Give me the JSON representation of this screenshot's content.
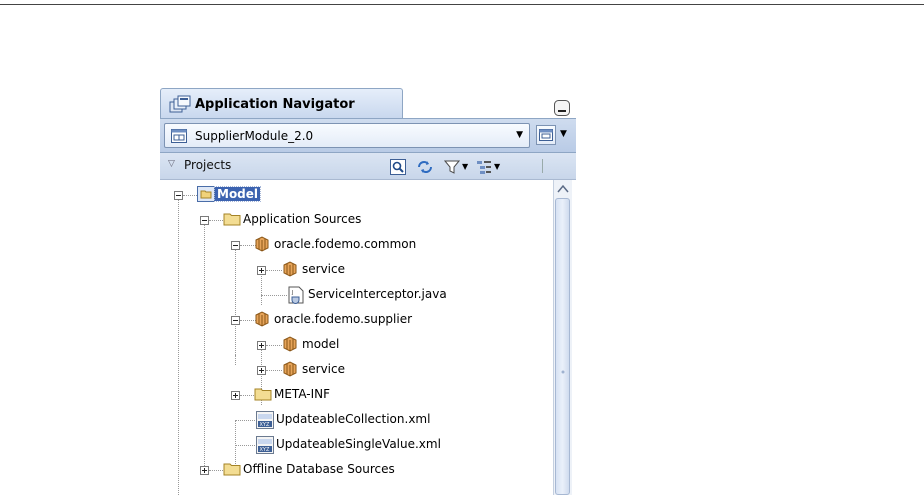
{
  "navigator": {
    "title": "Application Navigator",
    "working_set": "SupplierModule_2.0",
    "projects_label": "Projects"
  },
  "tree": [
    {
      "label": "Model",
      "icon": "project-icon",
      "expander": "minus",
      "selected": true
    },
    {
      "label": "Application Sources",
      "icon": "folder-icon",
      "expander": "minus"
    },
    {
      "label": "oracle.fodemo.common",
      "icon": "package-icon",
      "expander": "minus"
    },
    {
      "label": "service",
      "icon": "package-icon",
      "expander": "plus"
    },
    {
      "label": "ServiceInterceptor.java",
      "icon": "java-file-icon",
      "expander": "none"
    },
    {
      "label": "oracle.fodemo.supplier",
      "icon": "package-icon",
      "expander": "minus"
    },
    {
      "label": "model",
      "icon": "package-icon",
      "expander": "plus"
    },
    {
      "label": "service",
      "icon": "package-icon",
      "expander": "plus"
    },
    {
      "label": "META-INF",
      "icon": "folder-icon",
      "expander": "plus"
    },
    {
      "label": "UpdateableCollection.xml",
      "icon": "xml-file-icon",
      "expander": "none"
    },
    {
      "label": "UpdateableSingleValue.xml",
      "icon": "xml-file-icon",
      "expander": "none"
    },
    {
      "label": "Offline Database Sources",
      "icon": "folder-icon",
      "expander": "plus"
    }
  ]
}
